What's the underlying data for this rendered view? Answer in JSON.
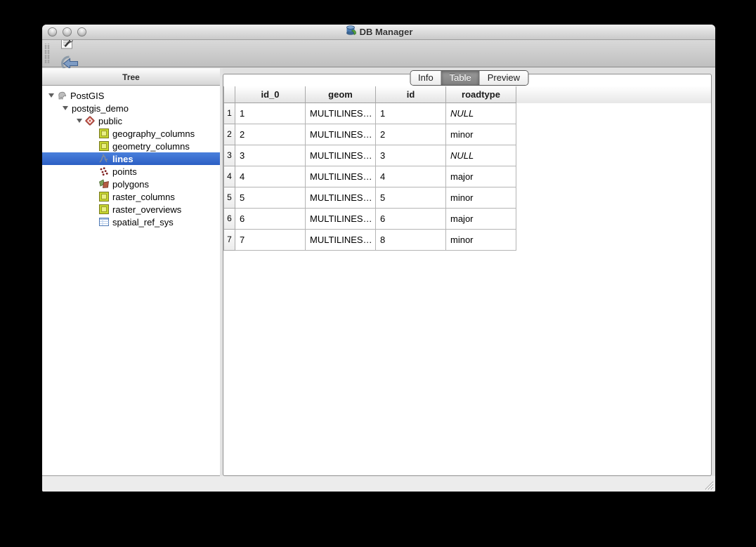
{
  "window": {
    "title": "DB Manager"
  },
  "titlebar": {
    "buttons": [
      {
        "name": "close-button",
        "icon": "close-circle-icon"
      },
      {
        "name": "minimize-button",
        "icon": "minimize-circle-icon"
      },
      {
        "name": "zoom-button",
        "icon": "zoom-circle-icon"
      }
    ],
    "app_icon": "db-manager-icon"
  },
  "toolbar": {
    "buttons": [
      {
        "name": "refresh",
        "icon": "refresh-icon"
      },
      {
        "name": "sql-window",
        "icon": "sql-window-icon"
      },
      {
        "name": "import-layer",
        "icon": "import-layer-icon"
      },
      {
        "name": "export-to-file",
        "icon": "export-file-icon"
      }
    ]
  },
  "tree": {
    "header": "Tree",
    "items": [
      {
        "label": "PostGIS",
        "depth": 0,
        "icon": "postgis-elephant-icon",
        "expanded": true
      },
      {
        "label": "postgis_demo",
        "depth": 1,
        "icon": null,
        "expanded": true
      },
      {
        "label": "public",
        "depth": 2,
        "icon": "schema-icon",
        "expanded": true
      },
      {
        "label": "geography_columns",
        "depth": 3,
        "icon": "geometry-table-icon"
      },
      {
        "label": "geometry_columns",
        "depth": 3,
        "icon": "geometry-table-icon"
      },
      {
        "label": "lines",
        "depth": 3,
        "icon": "lines-icon",
        "selected": true
      },
      {
        "label": "points",
        "depth": 3,
        "icon": "points-icon"
      },
      {
        "label": "polygons",
        "depth": 3,
        "icon": "polygons-icon"
      },
      {
        "label": "raster_columns",
        "depth": 3,
        "icon": "geometry-table-icon"
      },
      {
        "label": "raster_overviews",
        "depth": 3,
        "icon": "geometry-table-icon"
      },
      {
        "label": "spatial_ref_sys",
        "depth": 3,
        "icon": "srs-table-icon"
      }
    ]
  },
  "tabs": {
    "items": [
      {
        "label": "Info",
        "selected": false
      },
      {
        "label": "Table",
        "selected": true
      },
      {
        "label": "Preview",
        "selected": false
      }
    ]
  },
  "table": {
    "columns": [
      "id_0",
      "geom",
      "id",
      "roadtype"
    ],
    "rows": [
      {
        "num": "1",
        "id_0": "1",
        "geom": "MULTILINES…",
        "id": "1",
        "roadtype": "NULL",
        "roadtype_italic": true
      },
      {
        "num": "2",
        "id_0": "2",
        "geom": "MULTILINES…",
        "id": "2",
        "roadtype": "minor",
        "roadtype_italic": false
      },
      {
        "num": "3",
        "id_0": "3",
        "geom": "MULTILINES…",
        "id": "3",
        "roadtype": "NULL",
        "roadtype_italic": true
      },
      {
        "num": "4",
        "id_0": "4",
        "geom": "MULTILINES…",
        "id": "4",
        "roadtype": "major",
        "roadtype_italic": false
      },
      {
        "num": "5",
        "id_0": "5",
        "geom": "MULTILINES…",
        "id": "5",
        "roadtype": "minor",
        "roadtype_italic": false
      },
      {
        "num": "6",
        "id_0": "6",
        "geom": "MULTILINES…",
        "id": "6",
        "roadtype": "major",
        "roadtype_italic": false
      },
      {
        "num": "7",
        "id_0": "7",
        "geom": "MULTILINES…",
        "id": "8",
        "roadtype": "minor",
        "roadtype_italic": false
      }
    ]
  },
  "colors": {
    "selection_blue_top": "#4a80dc",
    "selection_blue_bottom": "#2c5fc4",
    "tab_selected_gray": "#8b8b8b",
    "window_chrome": "#d0d0d0",
    "grid_line": "#b4b4b4"
  }
}
